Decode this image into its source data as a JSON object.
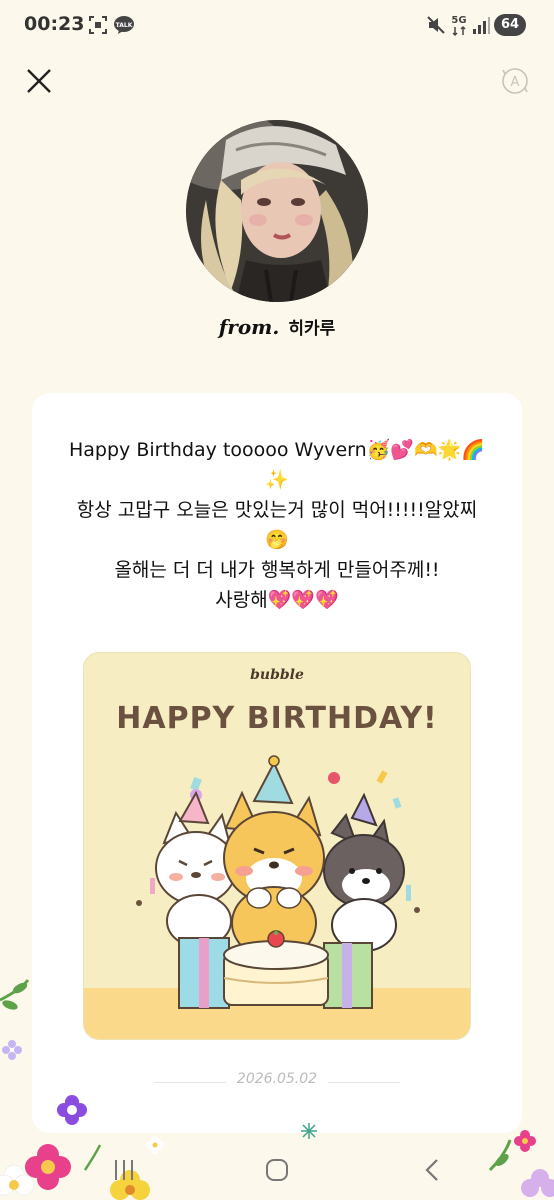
{
  "status_bar": {
    "time": "00:23",
    "battery": "64",
    "network": "5G",
    "icons": [
      "screenshot-icon",
      "kakaotalk-icon",
      "mute-icon",
      "5g-icon",
      "signal-icon",
      "battery-icon"
    ]
  },
  "header": {
    "close_icon": "close-icon",
    "translate_icon": "translate-icon"
  },
  "sender": {
    "from_prefix": "from.",
    "name": "히카루"
  },
  "message": {
    "lines": [
      "Happy Birthday tooooo Wyvern🥳💕🫶🌟🌈",
      "✨",
      "항상 고맙구 오늘은 맛있는거 많이 먹어!!!!!알았찌",
      "🤭",
      "올해는 더 더 내가 행복하게 만들어주께!!",
      "사랑해💖💖💖"
    ]
  },
  "birthday_card": {
    "logo": "bubble",
    "title": "HAPPY BIRTHDAY!"
  },
  "date": "2026.05.02",
  "colors": {
    "background": "#fcf8ec",
    "card": "#ffffff",
    "birthday_card_bg": "#f7edc3",
    "title_brown": "#6b5240"
  },
  "nav": {
    "icons": [
      "recent-apps-icon",
      "home-icon",
      "back-icon"
    ]
  }
}
